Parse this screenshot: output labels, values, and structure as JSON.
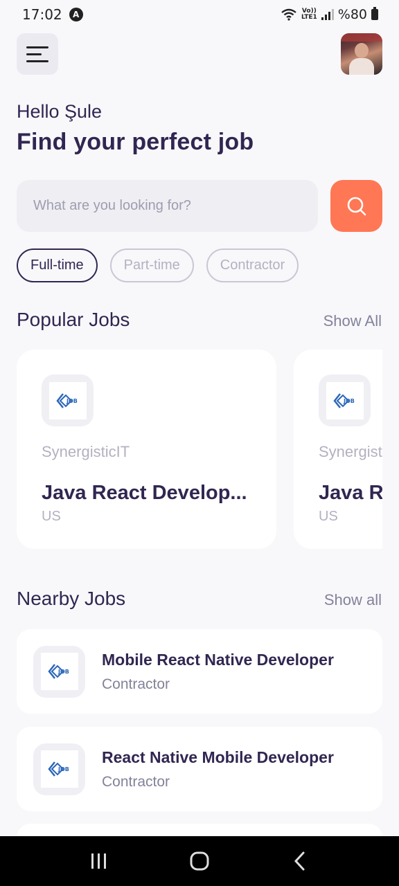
{
  "status_bar": {
    "time": "17:02",
    "app_icon": "A",
    "battery_text": "%80",
    "volte_line1": "Vo))",
    "volte_line2": "LTE1"
  },
  "header": {
    "menu_icon": "hamburger-menu-icon",
    "avatar": "profile-avatar"
  },
  "greeting": {
    "hello": "Hello Şule",
    "headline": "Find your perfect job"
  },
  "search": {
    "placeholder": "What are you looking for?",
    "button_icon": "search-icon",
    "accent_color": "#FF7754"
  },
  "job_types": [
    {
      "label": "Full-time",
      "active": true
    },
    {
      "label": "Part-time",
      "active": false
    },
    {
      "label": "Contractor",
      "active": false
    }
  ],
  "popular": {
    "title": "Popular Jobs",
    "show_all": "Show All",
    "jobs": [
      {
        "company": "SynergisticIT",
        "title": "Java React Develop...",
        "location": "US"
      },
      {
        "company": "SynergisticIT",
        "title": "Java React Developer",
        "location": "US"
      }
    ]
  },
  "nearby": {
    "title": "Nearby Jobs",
    "show_all": "Show all",
    "jobs": [
      {
        "title": "Mobile React Native Developer",
        "type": "Contractor"
      },
      {
        "title": "React Native Mobile Developer",
        "type": "Contractor"
      }
    ]
  },
  "colors": {
    "primary": "#312651",
    "secondary": "#83829A",
    "tertiary": "#FF7754",
    "background": "#F8F8FB"
  }
}
